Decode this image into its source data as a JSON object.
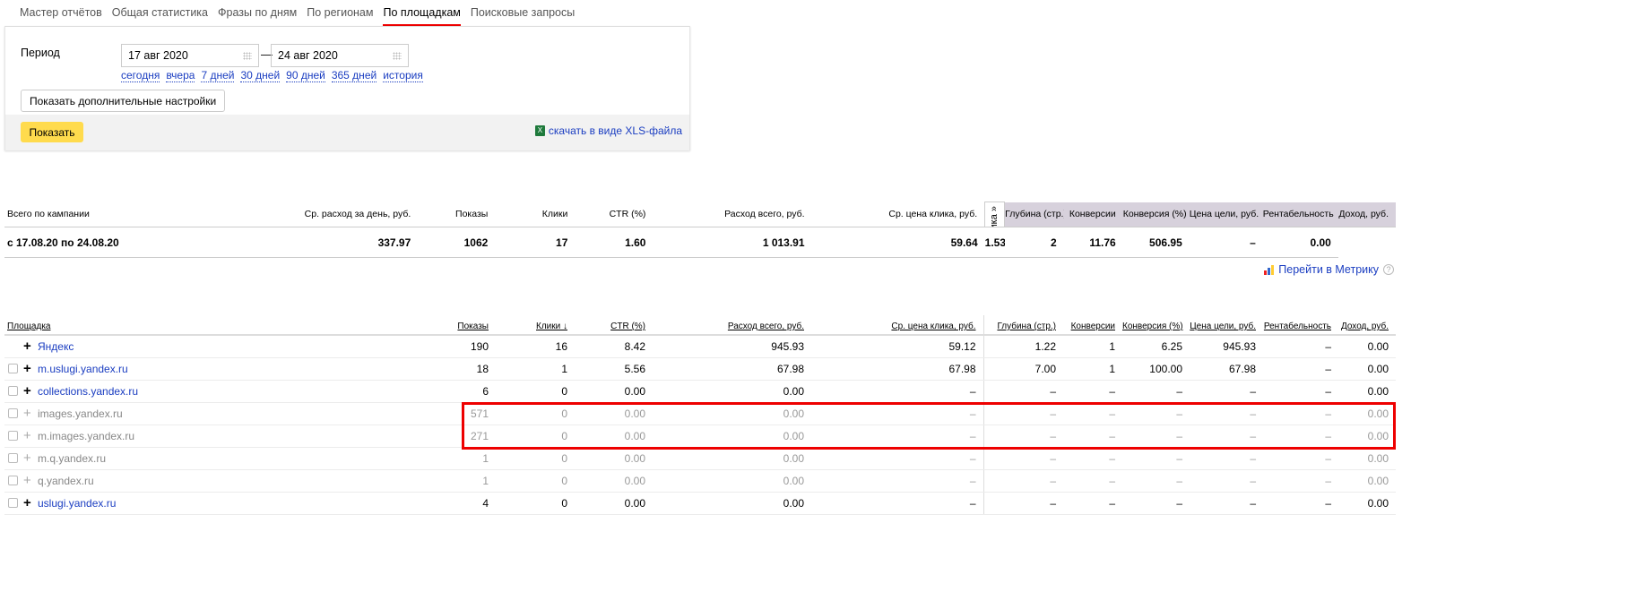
{
  "tabs": [
    "Мастер отчётов",
    "Общая статистика",
    "Фразы по дням",
    "По регионам",
    "По площадкам",
    "Поисковые запросы"
  ],
  "active_tab": 4,
  "filter": {
    "period_label": "Период",
    "date_from": "17 авг 2020",
    "date_to": "24 авг 2020",
    "dash": "—",
    "quick": [
      "сегодня",
      "вчера",
      "7 дней",
      "30 дней",
      "90 дней",
      "365 дней",
      "история"
    ],
    "more_settings": "Показать дополнительные настройки",
    "show": "Показать",
    "xls": "скачать в виде XLS-файла"
  },
  "summary": {
    "headers": [
      "Всего по кампании",
      "Ср. расход за день, руб.",
      "Показы",
      "Клики",
      "CTR (%)",
      "Расход всего, руб.",
      "Ср. цена клика, руб.",
      "Глубина (стр.)",
      "Конверсии",
      "Конверсия (%)",
      "Цена цели, руб.",
      "Рентабельность",
      "Доход, руб."
    ],
    "metrika_tab": "Метрика »",
    "row": [
      "с 17.08.20 по 24.08.20",
      "337.97",
      "1062",
      "17",
      "1.60",
      "1 013.91",
      "59.64",
      "1.53",
      "2",
      "11.76",
      "506.95",
      "–",
      "0.00"
    ]
  },
  "metrika_link": "Перейти в Метрику",
  "metrika_help": "?",
  "platforms": {
    "headers": [
      "Площадка",
      "Показы",
      "Клики ↓",
      "CTR (%)",
      "Расход всего, руб.",
      "Ср. цена клика, руб.",
      "Глубина (стр.)",
      "Конверсии",
      "Конверсия (%)",
      "Цена цели, руб.",
      "Рентабельность",
      "Доход, руб."
    ],
    "rows": [
      {
        "name": "Яндекс",
        "checkbox": false,
        "dim": false,
        "v": [
          "190",
          "16",
          "8.42",
          "945.93",
          "59.12",
          "1.22",
          "1",
          "6.25",
          "945.93",
          "–",
          "0.00"
        ]
      },
      {
        "name": "m.uslugi.yandex.ru",
        "checkbox": true,
        "dim": false,
        "v": [
          "18",
          "1",
          "5.56",
          "67.98",
          "67.98",
          "7.00",
          "1",
          "100.00",
          "67.98",
          "–",
          "0.00"
        ]
      },
      {
        "name": "collections.yandex.ru",
        "checkbox": true,
        "dim": false,
        "v": [
          "6",
          "0",
          "0.00",
          "0.00",
          "–",
          "–",
          "–",
          "–",
          "–",
          "–",
          "0.00"
        ]
      },
      {
        "name": "images.yandex.ru",
        "checkbox": true,
        "dim": true,
        "v": [
          "571",
          "0",
          "0.00",
          "0.00",
          "–",
          "–",
          "–",
          "–",
          "–",
          "–",
          "0.00"
        ]
      },
      {
        "name": "m.images.yandex.ru",
        "checkbox": true,
        "dim": true,
        "v": [
          "271",
          "0",
          "0.00",
          "0.00",
          "–",
          "–",
          "–",
          "–",
          "–",
          "–",
          "0.00"
        ]
      },
      {
        "name": "m.q.yandex.ru",
        "checkbox": true,
        "dim": true,
        "v": [
          "1",
          "0",
          "0.00",
          "0.00",
          "–",
          "–",
          "–",
          "–",
          "–",
          "–",
          "0.00"
        ]
      },
      {
        "name": "q.yandex.ru",
        "checkbox": true,
        "dim": true,
        "v": [
          "1",
          "0",
          "0.00",
          "0.00",
          "–",
          "–",
          "–",
          "–",
          "–",
          "–",
          "0.00"
        ]
      },
      {
        "name": "uslugi.yandex.ru",
        "checkbox": true,
        "dim": false,
        "v": [
          "4",
          "0",
          "0.00",
          "0.00",
          "–",
          "–",
          "–",
          "–",
          "–",
          "–",
          "0.00"
        ]
      }
    ]
  },
  "colors": {
    "accent": "#e00000",
    "link": "#1a3dc1",
    "button": "#ffdb4d"
  }
}
